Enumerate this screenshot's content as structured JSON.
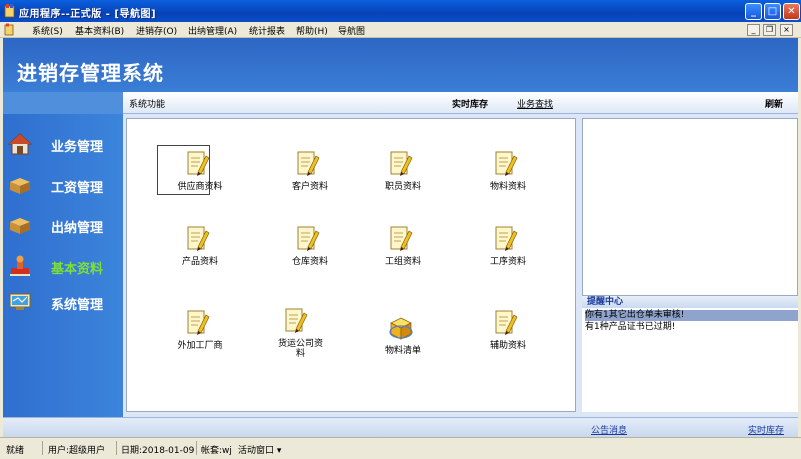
{
  "window": {
    "title": "应用程序--正式版 - [导航图]",
    "min": "_",
    "max": "□",
    "close": "✕"
  },
  "menu": [
    "系统(S)",
    "基本资料(B)",
    "进销存(O)",
    "出纳管理(A)",
    "统计报表",
    "帮助(H)",
    "导航图"
  ],
  "mdi": {
    "min": "_",
    "restore": "❐",
    "close": "×"
  },
  "header": {
    "title": "进销存管理系统"
  },
  "sidebar": {
    "items": [
      {
        "label": "业务管理",
        "icon": "house-icon"
      },
      {
        "label": "工资管理",
        "icon": "boxes-icon"
      },
      {
        "label": "出纳管理",
        "icon": "boxes-icon"
      },
      {
        "label": "基本资料",
        "icon": "stamp-icon",
        "active": true
      },
      {
        "label": "系统管理",
        "icon": "monitor-icon"
      }
    ]
  },
  "funcbar": {
    "section": "系统功能",
    "tab_stock": "实时库存",
    "tab_query": "业务查找",
    "refresh": "刷新"
  },
  "tiles": [
    {
      "label": "供应商资料",
      "icon": "document-pencil-icon",
      "selected": true
    },
    {
      "label": "客户资料",
      "icon": "document-pencil-icon"
    },
    {
      "label": "职员资料",
      "icon": "document-pencil-icon"
    },
    {
      "label": "物料资料",
      "icon": "document-pencil-icon"
    },
    {
      "label": "产品资料",
      "icon": "document-pencil-icon"
    },
    {
      "label": "仓库资料",
      "icon": "document-pencil-icon"
    },
    {
      "label": "工组资料",
      "icon": "document-pencil-icon"
    },
    {
      "label": "工序资料",
      "icon": "document-pencil-icon"
    },
    {
      "label": "外加工厂商",
      "icon": "document-pencil-icon"
    },
    {
      "label": "货运公司资料",
      "icon": "document-pencil-icon"
    },
    {
      "label": "物料清单",
      "icon": "cube-icon"
    },
    {
      "label": "辅助资料",
      "icon": "document-pencil-icon"
    }
  ],
  "reminder": {
    "title": "提醒中心",
    "messages": [
      "你有1其它出仓单未审核!",
      "有1种产品证书已过期!"
    ]
  },
  "bottombar": {
    "notice": "公告消息",
    "stock": "实时库存"
  },
  "status": {
    "state": "就绪",
    "user": "用户:超级用户",
    "date": "日期:2018-01-09",
    "account": "帐套:wj",
    "active_window": "活动窗口 ▾"
  }
}
